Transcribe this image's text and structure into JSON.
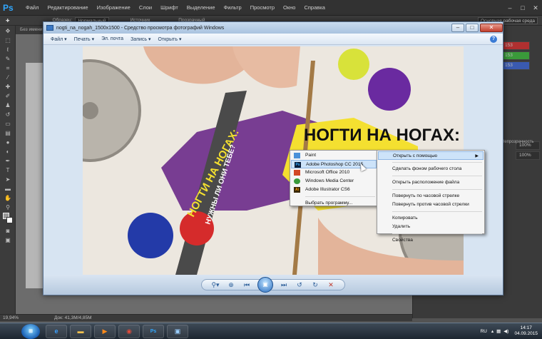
{
  "photoshop": {
    "logo": "Ps",
    "menus": [
      "Файл",
      "Редактирование",
      "Изображение",
      "Слои",
      "Шрифт",
      "Выделение",
      "Фильтр",
      "Просмотр",
      "Окно",
      "Справка"
    ],
    "options": {
      "sample_label": "Образец:",
      "sample_value": "Нормальный",
      "opt1": "Источник",
      "opt2": "Прозрачный",
      "workspace": "Основная рабочая среда"
    },
    "doc_tab": "Без имени",
    "status_zoom": "19,94%",
    "status_doc": "Док: 41,3М/4,85М",
    "right_panel": {
      "rgb_values": [
        "153",
        "153",
        "153"
      ],
      "opacity_label": "Непрозрачность",
      "opacity_value": "100%",
      "fill_value": "100%"
    }
  },
  "viewer": {
    "title": "nogti_na_nogah_1500x1500 - Средство просмотра фотографий Windows",
    "menu": [
      "Файл",
      "Печать",
      "Эл. почта",
      "Запись",
      "Открыть"
    ],
    "help": "?",
    "photo": {
      "headline": "НОГТИ НА НОГАХ:",
      "sub": "НУЖНЫ ЛИ ОНИ ТЕБЕ?"
    }
  },
  "context_main": {
    "items": [
      {
        "label": "Открыть с помощью",
        "submenu": true
      },
      {
        "label": "Сделать фоном рабочего стола"
      },
      {
        "label": "Открыть расположение файла"
      },
      {
        "label": "Повернуть по часовой стрелке"
      },
      {
        "label": "Повернуть против часовой стрелки"
      },
      {
        "label": "Копировать"
      },
      {
        "label": "Удалить"
      },
      {
        "label": "Свойства"
      }
    ]
  },
  "context_sub": {
    "items": [
      {
        "label": "Paint",
        "icon": "paint-icon",
        "color": "#4a90d9"
      },
      {
        "label": "Adobe Photoshop CC 2015",
        "icon": "photoshop-icon",
        "color": "#0b1e3a"
      },
      {
        "label": "Microsoft Office 2010",
        "icon": "office-icon",
        "color": "#d24726"
      },
      {
        "label": "Windows Media Center",
        "icon": "media-center-icon",
        "color": "#3a9a3a"
      },
      {
        "label": "Adobe Illustrator CS6",
        "icon": "illustrator-icon",
        "color": "#3a2a0a"
      }
    ],
    "more": "Выбрать программу..."
  },
  "taskbar": {
    "lang": "RU",
    "time": "14:17",
    "date": "04.09.2015"
  },
  "colors": {
    "accent": "#31a8ff",
    "ps_bg": "#535353",
    "viewer_bg": "#d7e4f2",
    "menu_selected": "#cde3f9"
  }
}
